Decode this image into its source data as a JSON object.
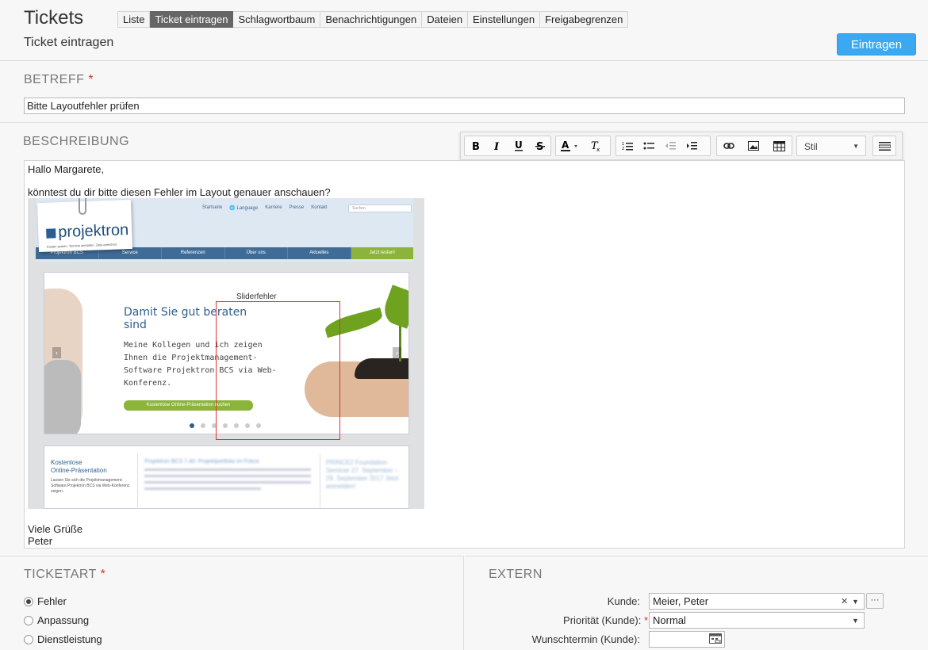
{
  "header": {
    "title": "Tickets",
    "subtitle": "Ticket eintragen",
    "tabs": [
      "Liste",
      "Ticket eintragen",
      "Schlagwortbaum",
      "Benachrichtigungen",
      "Dateien",
      "Einstellungen",
      "Freigabegrenzen"
    ],
    "active_tab": "Ticket eintragen",
    "submit_label": "Eintragen"
  },
  "betreff": {
    "label": "BETREFF",
    "required_mark": "*",
    "value": "Bitte Layoutfehler prüfen"
  },
  "beschreibung": {
    "label": "BESCHREIBUNG",
    "toolbar": {
      "style_label": "Stil",
      "buttons": [
        "bold-icon",
        "italic-icon",
        "underline-icon",
        "strikethrough-icon",
        "text-color-icon",
        "remove-format-icon",
        "numbered-list-icon",
        "bullet-list-icon",
        "outdent-icon",
        "indent-icon",
        "link-icon",
        "image-icon",
        "table-icon",
        "source-icon"
      ]
    },
    "lines": {
      "greeting": "Hallo Margarete,",
      "request": "könntest du dir bitte diesen Fehler im Layout genauer anschauen?",
      "closing": "Viele Grüße",
      "signature": "Peter"
    },
    "embedded_image": {
      "logo": "projektron",
      "tagline": "Kosten sparen. Termine einhalten. Ziele erreichen.",
      "top_links": [
        "Startseite",
        "Language",
        "Karriere",
        "Presse",
        "Kontakt"
      ],
      "search_placeholder": "Suchen",
      "nav": [
        "Projektron BCS",
        "Service",
        "Referenzen",
        "Über uns",
        "Aktuelles",
        "Jetzt testen!"
      ],
      "annotation": "Sliderfehler",
      "slider_heading_1": "Damit Sie gut beraten",
      "slider_heading_2": "sind",
      "slider_text_1": "Meine Kollegen und ich zeigen",
      "slider_text_2": "Ihnen die Projektmanagement-",
      "slider_text_3": "Software Projektron BCS via Web-",
      "slider_text_4": "Konferenz.",
      "slider_button": "Kostenlose Online-Präsentation buchen",
      "teaser_title_1": "Kostenlose",
      "teaser_title_2": "Online-Präsentation",
      "teaser_text": "Lassen Sie sich die Projektmanagement-Software Projektron BCS via Web-Konferenz zeigen.",
      "news_title": "Projektron BCS 7.40: Projektportfolio im Fokus",
      "event_title": "PRINCE2 Foundation Seminar 27. September – 29. September 2017 Jetzt anmelden!",
      "slide_count": 7,
      "active_slide": 1
    }
  },
  "ticketart": {
    "label": "TICKETART",
    "required_mark": "*",
    "options": [
      "Fehler",
      "Anpassung",
      "Dienstleistung"
    ],
    "selected": "Fehler"
  },
  "extern": {
    "label": "EXTERN",
    "kunde_label": "Kunde:",
    "kunde_value": "Meier, Peter",
    "more_label": "···",
    "prioritaet_label": "Priorität (Kunde):",
    "prioritaet_required": "*",
    "prioritaet_value": "Normal",
    "wunschtermin_label": "Wunschtermin (Kunde):",
    "wunschtermin_value": ""
  }
}
